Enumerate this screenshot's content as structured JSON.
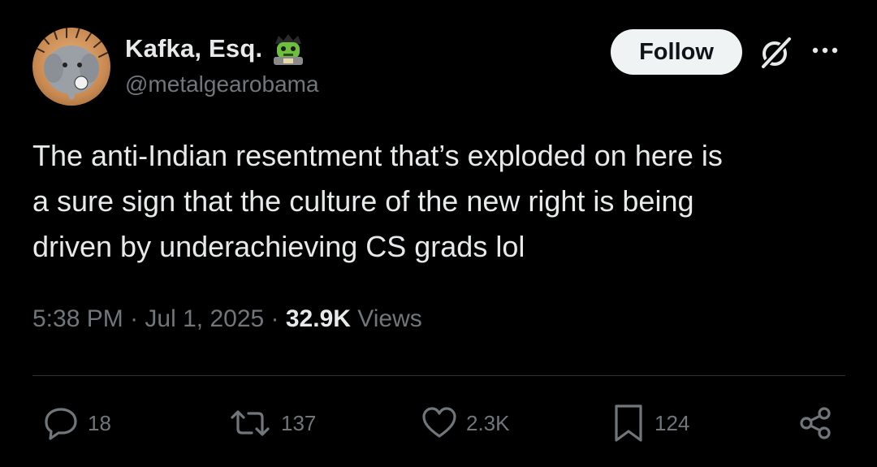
{
  "author": {
    "display_name": "Kafka, Esq.",
    "name_emoji_icon": "zombie-face-icon",
    "handle": "@metalgearobama",
    "avatar_icon": "elephant-porcupine-avatar"
  },
  "header": {
    "follow_label": "Follow",
    "grok_icon": "grok-icon",
    "more_icon": "more-dots-icon"
  },
  "tweet": {
    "text_lines": [
      "The anti-Indian resentment that’s exploded on here is",
      "a sure sign that the culture of the new right is being",
      "driven by underachieving CS grads lol"
    ]
  },
  "meta": {
    "time": "5:38 PM",
    "sep1": " · ",
    "date": "Jul 1, 2025",
    "sep2": " · ",
    "views_count": "32.9K",
    "views_label": " Views"
  },
  "actions": {
    "replies": "18",
    "reposts": "137",
    "likes": "2.3K",
    "bookmarks": "124"
  },
  "colors": {
    "background": "#000000",
    "text": "#e7e9ea",
    "muted": "#71767b",
    "divider": "#2f3336",
    "follow_bg": "#eff3f4"
  }
}
